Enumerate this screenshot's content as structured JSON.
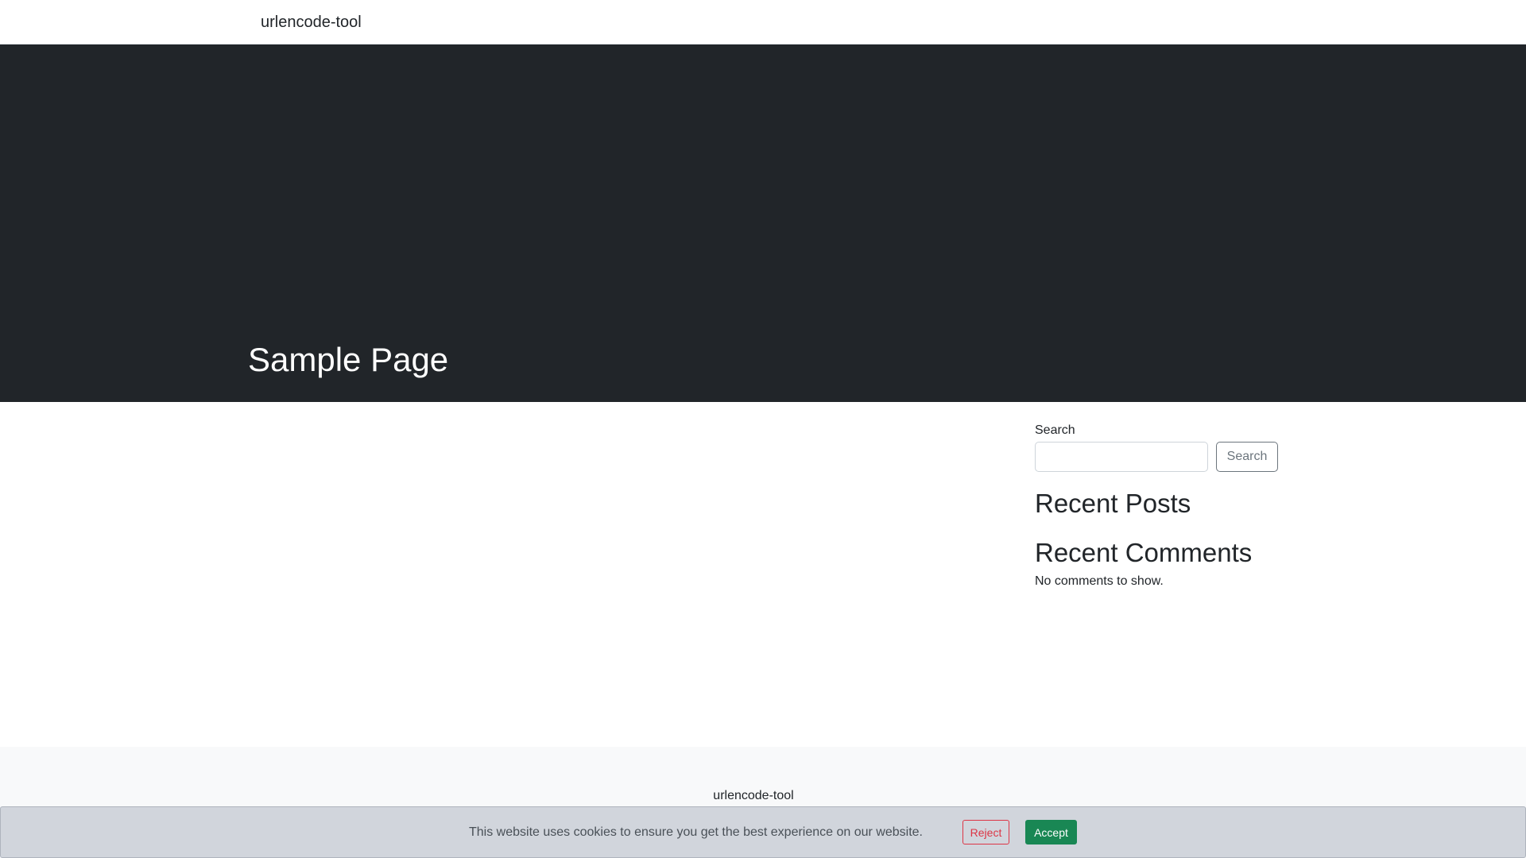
{
  "navbar": {
    "brand": "urlencode-tool"
  },
  "hero": {
    "title": "Sample Page"
  },
  "sidebar": {
    "search_label": "Search",
    "search_value": "",
    "search_button": "Search",
    "recent_posts_heading": "Recent Posts",
    "recent_comments_heading": "Recent Comments",
    "no_comments_text": "No comments to show."
  },
  "footer": {
    "brand": "urlencode-tool"
  },
  "cookie_banner": {
    "message": "This website uses cookies to ensure you get the best experience on our website.",
    "reject_label": "Reject",
    "accept_label": "Accept"
  },
  "colors": {
    "hero_background": "#212529",
    "footer_background": "#f8f9fa",
    "cookie_background": "#d1d5dc",
    "reject_color": "#dc3545",
    "accept_color": "#198754"
  }
}
